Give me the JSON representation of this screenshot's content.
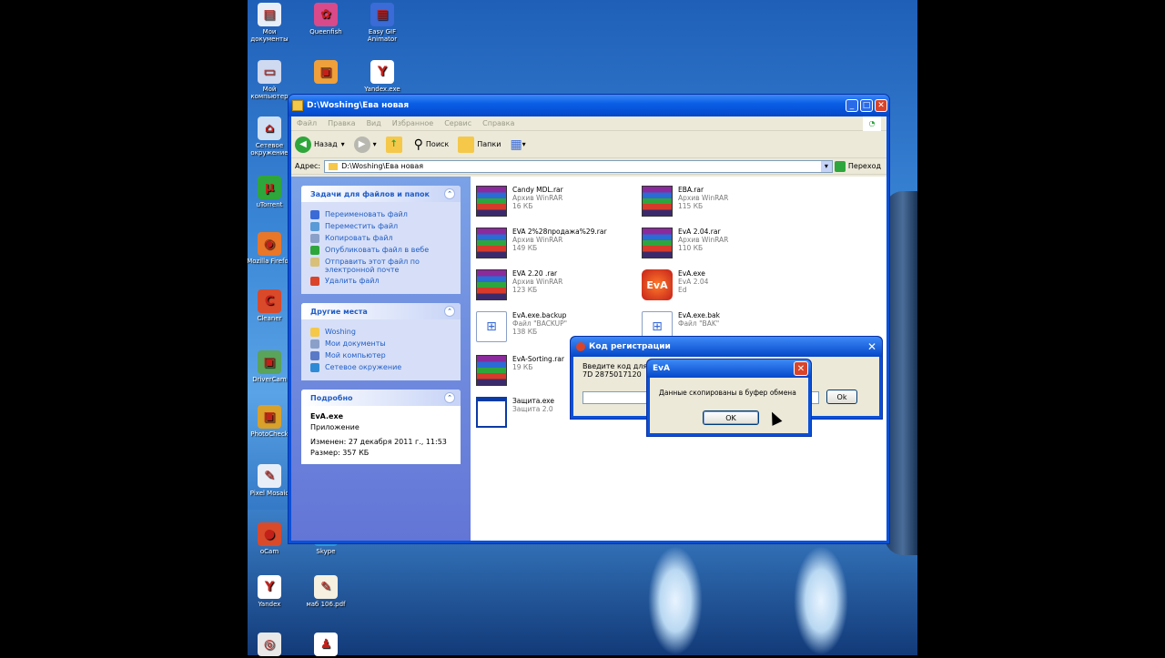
{
  "desktop": {
    "icons": [
      {
        "label": "Мои документы",
        "icon": "folder-docs-icon",
        "color": "#e8eef8",
        "glyph": "▤"
      },
      {
        "label": "Queenfish",
        "icon": "app-icon",
        "color": "#d94a8a",
        "glyph": "✿"
      },
      {
        "label": "Easy GIF Animator",
        "icon": "gif-animator-icon",
        "color": "#3a6bd6",
        "glyph": "▦"
      },
      {
        "label": "Мой компьютер",
        "icon": "computer-icon",
        "color": "#cfd9f0",
        "glyph": "▭"
      },
      {
        "label": "",
        "icon": "app-icon",
        "color": "#f0a03a",
        "glyph": "▣"
      },
      {
        "label": "Yandex.exe",
        "icon": "yandex-icon",
        "color": "#ffffff",
        "glyph": "Y"
      },
      {
        "label": "Сетевое окружение",
        "icon": "network-icon",
        "color": "#cfe0f5",
        "glyph": "⌂"
      },
      {
        "label": "uTorrent",
        "icon": "utorrent-icon",
        "color": "#2fa63b",
        "glyph": "µ"
      },
      {
        "label": "Mozilla Firefox",
        "icon": "firefox-icon",
        "color": "#e8772a",
        "glyph": "◉"
      },
      {
        "label": "Cleaner",
        "icon": "cleaner-icon",
        "color": "#d94a2a",
        "glyph": "C"
      },
      {
        "label": "DriverCam",
        "icon": "app-icon",
        "color": "#5aa35a",
        "glyph": "▣"
      },
      {
        "label": "PhotoCheck",
        "icon": "app-icon",
        "color": "#d9a02a",
        "glyph": "▣"
      },
      {
        "label": "Pixel Mosaic",
        "icon": "pencil-icon",
        "color": "#e8eef8",
        "glyph": "✎"
      },
      {
        "label": "oCam",
        "icon": "ocam-icon",
        "color": "#d94a2a",
        "glyph": "●"
      },
      {
        "label": "Skype",
        "icon": "skype-icon",
        "color": "#2a9ad9",
        "glyph": "S"
      },
      {
        "label": "Yandex",
        "icon": "yandex-icon",
        "color": "#ffffff",
        "glyph": "Y"
      },
      {
        "label": "маб 106.pdf",
        "icon": "pdf-icon",
        "color": "#f5f0e0",
        "glyph": "✎"
      },
      {
        "label": "",
        "icon": "chrome-icon",
        "color": "#e8e8e8",
        "glyph": "◎"
      },
      {
        "label": "",
        "icon": "app-icon",
        "color": "#ffffff",
        "glyph": "♟"
      }
    ]
  },
  "explorer": {
    "title": "D:\\Woshing\\Ева новая",
    "menu": [
      "Файл",
      "Правка",
      "Вид",
      "Избранное",
      "Сервис",
      "Справка"
    ],
    "toolbar": {
      "back": "Назад",
      "search": "Поиск",
      "folders": "Папки"
    },
    "address": {
      "label": "Адрес:",
      "value": "D:\\Woshing\\Ева новая",
      "go": "Переход"
    },
    "tasks_panel": {
      "title": "Задачи для файлов и папок",
      "items": [
        {
          "label": "Переименовать файл",
          "icon": "rename-icon",
          "color": "#3b6bd6"
        },
        {
          "label": "Переместить файл",
          "icon": "move-icon",
          "color": "#5a9ad6"
        },
        {
          "label": "Копировать файл",
          "icon": "copy-icon",
          "color": "#8aa0c8"
        },
        {
          "label": "Опубликовать файл в вебе",
          "icon": "globe-icon",
          "color": "#2fa63b"
        },
        {
          "label": "Отправить этот файл по электронной почте",
          "icon": "mail-icon",
          "color": "#d9c07a"
        },
        {
          "label": "Удалить файл",
          "icon": "delete-icon",
          "color": "#d9442a"
        }
      ]
    },
    "places_panel": {
      "title": "Другие места",
      "items": [
        {
          "label": "Woshing",
          "icon": "folder-icon",
          "color": "#f5c84a"
        },
        {
          "label": "Мои документы",
          "icon": "folder-docs-icon",
          "color": "#8aa0c8"
        },
        {
          "label": "Мой компьютер",
          "icon": "computer-icon",
          "color": "#5a7ac8"
        },
        {
          "label": "Сетевое окружение",
          "icon": "network-icon",
          "color": "#2f8ad6"
        }
      ]
    },
    "details_panel": {
      "title": "Подробно",
      "name": "EvA.exe",
      "type": "Приложение",
      "modified": "Изменен: 27 декабря 2011 г., 11:53",
      "size": "Размер: 357 КБ"
    },
    "files": [
      {
        "name": "Candy MDL.rar",
        "type": "Архив WinRAR",
        "size": "16 КБ",
        "kind": "rar"
      },
      {
        "name": "EBA.rar",
        "type": "Архив WinRAR",
        "size": "115 КБ",
        "kind": "rar"
      },
      {
        "name": "EVA 2%28продажа%29.rar",
        "type": "Архив WinRAR",
        "size": "149 КБ",
        "kind": "rar"
      },
      {
        "name": "EvA 2.04.rar",
        "type": "Архив WinRAR",
        "size": "110 КБ",
        "kind": "rar"
      },
      {
        "name": "EVA 2.20 .rar",
        "type": "Архив WinRAR",
        "size": "123 КБ",
        "kind": "rar"
      },
      {
        "name": "EvA.exe",
        "type": "EvA 2.04",
        "size": "Ed",
        "kind": "exe"
      },
      {
        "name": "EvA.exe.backup",
        "type": "Файл \"BACKUP\"",
        "size": "138 КБ",
        "kind": "doc"
      },
      {
        "name": "EvA.exe.bak",
        "type": "Файл \"BAK\"",
        "size": "",
        "kind": "doc"
      },
      {
        "name": "EvA-Sorting.rar",
        "type": "",
        "size": "19 КБ",
        "kind": "rar"
      },
      {
        "name": "Защита.exe",
        "type": "Защита 2.0",
        "size": "",
        "kind": "win"
      }
    ]
  },
  "reg_dialog": {
    "title": "Код регистрации",
    "prompt": "Введите код для",
    "code": "7D 2875017120",
    "ok": "Ok"
  },
  "eva_dialog": {
    "title": "EvA",
    "message": "Данные скопированы в буфер обмена",
    "ok": "OK"
  }
}
